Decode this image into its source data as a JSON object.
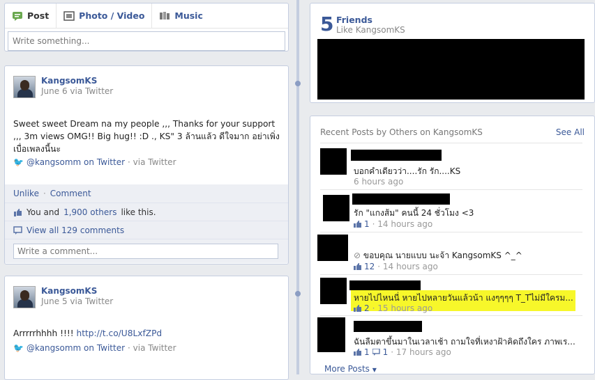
{
  "composer": {
    "tabs": [
      {
        "label": "Post",
        "icon": "status-icon"
      },
      {
        "label": "Photo / Video",
        "icon": "photo-icon"
      },
      {
        "label": "Music",
        "icon": "music-icon"
      }
    ],
    "placeholder": "Write something..."
  },
  "posts": [
    {
      "author": "KangsomKS",
      "meta": "June 6 via Twitter",
      "text": "Sweet sweet Dream na my people ,,, Thanks for your support ,,, 3m views OMG!! Big hug!! :D ., KS\" 3 ล้านแล้ว ดีใจมาก อย่าเพิ่งเบื่อเพลงนี้นะ",
      "twitter_handle": "@kangsomm on Twitter",
      "via": "· via Twitter",
      "unlike": "Unlike",
      "comment": "Comment",
      "likes_prefix": "You and",
      "likes_link": "1,900 others",
      "likes_suffix": "like this.",
      "view_all": "View all 129 comments",
      "comment_placeholder": "Write a comment..."
    },
    {
      "author": "KangsomKS",
      "meta": "June 5 via Twitter",
      "text_prefix": "Arrrrrhhhh !!!! ",
      "text_link": "http://t.co/U8LxfZPd",
      "twitter_handle": "@kangsomm on Twitter",
      "via": "· via Twitter"
    }
  ],
  "friends": {
    "count": "5",
    "label": "Friends",
    "sub": "Like KangsomKS"
  },
  "recent": {
    "title": "Recent Posts by Others on KangsomKS",
    "see_all": "See All",
    "items": [
      {
        "text": "บอกคำเดียวว่า....รัก รัก....KS",
        "likes": "",
        "comments": "",
        "time": "6 hours ago"
      },
      {
        "text": "รัก \"แกงส้ม\" คนนี้ 24 ชั่วโมง <3",
        "likes": "1",
        "comments": "",
        "time": "· 14 hours ago"
      },
      {
        "text": "ขอบคุณ นายแบบ นะจ้า KangsomKS ^_^",
        "likes": "12",
        "comments": "",
        "time": "· 14 hours ago"
      },
      {
        "text": "หายไปไหนนี่ หายไปหลายวันแล้วน้า แงๆๆๆๆ T_Tไม่มีใครม...",
        "likes": "2",
        "comments": "",
        "time": "· 15 hours ago"
      },
      {
        "text": "ฉันลืมตาขึ้นมาในเวลาเช้า ถามใจที่เหงาฝ้าคิดถึงใคร ภาพเร...",
        "likes": "1",
        "comments": "1",
        "time": "· 17 hours ago"
      }
    ],
    "more": "More Posts"
  },
  "colors": {
    "link": "#3b5998",
    "highlight": "#f7f72a",
    "background": "#e9ebee"
  }
}
